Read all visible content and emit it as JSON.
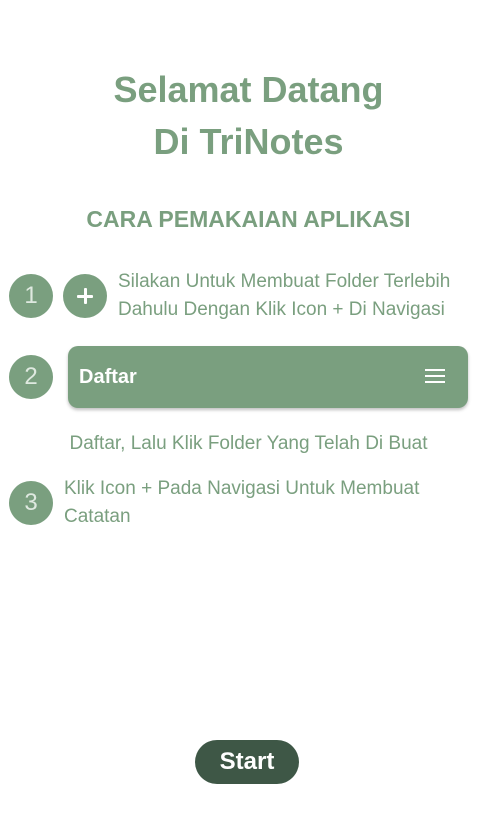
{
  "header": {
    "title_line1": "Selamat Datang",
    "title_line2": "Di TriNotes",
    "subtitle": "CARA PEMAKAIAN APLIKASI"
  },
  "steps": [
    {
      "number": "1",
      "icon": "plus-icon",
      "text_line1": "Silakan Untuk Membuat Folder Terlebih",
      "text_line2": "Dahulu Dengan Klik Icon + Di Navigasi"
    },
    {
      "number": "2",
      "navbar_title": "Daftar",
      "navbar_icon": "menu-icon",
      "caption": "Daftar, Lalu Klik Folder Yang Telah Di Buat"
    },
    {
      "number": "3",
      "text_line1": "Klik Icon + Pada Navigasi Untuk Membuat",
      "text_line2": "Catatan"
    }
  ],
  "start_button": {
    "label": "Start"
  },
  "colors": {
    "primary": "#7a9f7f",
    "button_dark": "#3e5746",
    "background": "#ffffff"
  }
}
